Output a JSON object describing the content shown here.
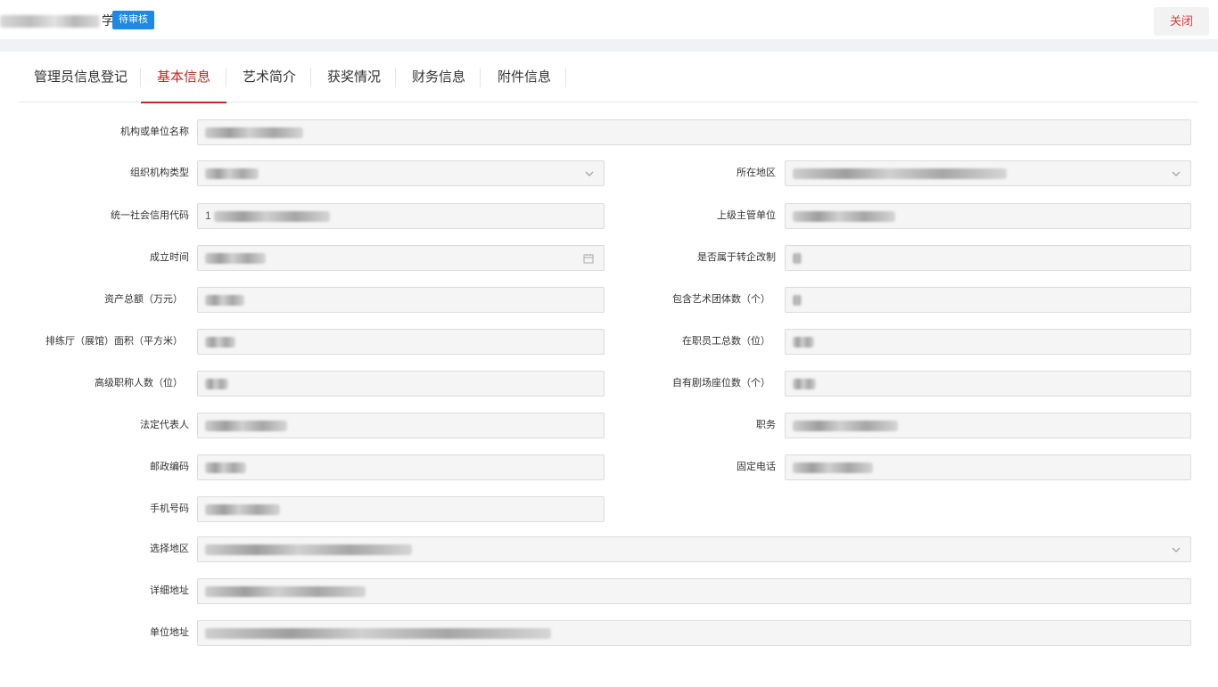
{
  "header": {
    "title_suffix": "学",
    "status_badge": "待审核",
    "close_label": "关闭"
  },
  "tabs": [
    {
      "label": "管理员信息登记"
    },
    {
      "label": "基本信息",
      "active": true
    },
    {
      "label": "艺术简介"
    },
    {
      "label": "获奖情况"
    },
    {
      "label": "财务信息"
    },
    {
      "label": "附件信息"
    }
  ],
  "form": {
    "org_name": {
      "label": "机构或单位名称"
    },
    "org_type": {
      "label": "组织机构类型"
    },
    "region": {
      "label": "所在地区"
    },
    "credit_code": {
      "label": "统一社会信用代码",
      "value_prefix": "1"
    },
    "superior_unit": {
      "label": "上级主管单位"
    },
    "founded_date": {
      "label": "成立时间"
    },
    "is_reformed": {
      "label": "是否属于转企改制"
    },
    "total_assets": {
      "label": "资产总额（万元）"
    },
    "art_groups": {
      "label": "包含艺术团体数（个）"
    },
    "rehearsal_area": {
      "label": "排练厅（展馆）面积（平方米）"
    },
    "staff_count": {
      "label": "在职员工总数（位）"
    },
    "senior_titles": {
      "label": "高级职称人数（位）"
    },
    "theater_seats": {
      "label": "自有剧场座位数（个）"
    },
    "legal_rep": {
      "label": "法定代表人"
    },
    "position": {
      "label": "职务"
    },
    "postal_code": {
      "label": "邮政编码"
    },
    "landline": {
      "label": "固定电话"
    },
    "mobile": {
      "label": "手机号码"
    },
    "select_region": {
      "label": "选择地区"
    },
    "detail_address": {
      "label": "详细地址"
    },
    "unit_address": {
      "label": "单位地址"
    }
  },
  "icons": {
    "dropdown": "chevron-down-icon",
    "date": "calendar-icon"
  },
  "colors": {
    "accent": "#c62828",
    "badge": "#1e88e5",
    "close_text": "#e53935"
  }
}
